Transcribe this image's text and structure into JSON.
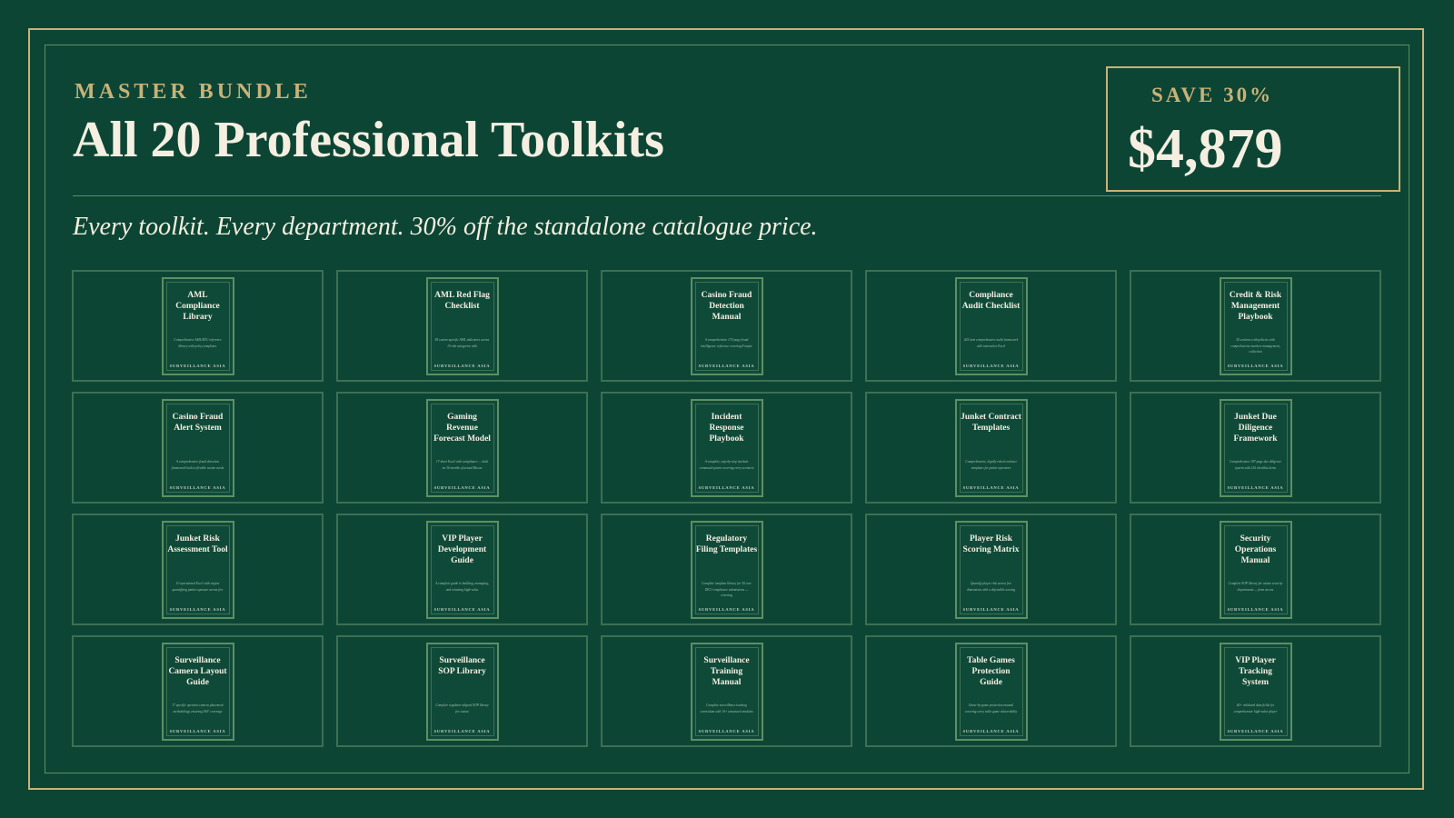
{
  "header": {
    "eyebrow": "MASTER BUNDLE",
    "title": "All 20 Professional Toolkits",
    "tagline": "Every toolkit. Every department. 30% off the standalone catalogue price."
  },
  "offer": {
    "save_label": "SAVE 30%",
    "price": "$4,879"
  },
  "colors": {
    "background": "#0d4535",
    "gold": "#c9b277",
    "cream": "#f4efe1",
    "green_border": "#5d8f63"
  },
  "books": [
    {
      "title": "AML Compliance Library",
      "desc": "Comprehensive AML/KYC reference library with policy templates.",
      "brand": "SURVEILLANCE ASIA"
    },
    {
      "title": "AML Red Flag Checklist",
      "desc": "85 casino-specific AML indicators across 10 risk categories with",
      "brand": "SURVEILLANCE ASIA"
    },
    {
      "title": "Casino Fraud Detection Manual",
      "desc": "A comprehensive 170-page fraud intelligence reference covering 8 major",
      "brand": "SURVEILLANCE ASIA"
    },
    {
      "title": "Compliance Audit Checklist",
      "desc": "265 item comprehensive audit framework with interactive Excel",
      "brand": "SURVEILLANCE ASIA"
    },
    {
      "title": "Credit & Risk Management Playbook",
      "desc": "45 sections with policies with comprehensive markers management, collection",
      "brand": "SURVEILLANCE ASIA"
    },
    {
      "title": "Casino Fraud Alert System",
      "desc": "A comprehensive fraud detection framework built to flexible casino needs",
      "brand": "SURVEILLANCE ASIA"
    },
    {
      "title": "Gaming Revenue Forecast Model",
      "desc": "17-sheet Excel with compliance — built on 36 months of actual Macau",
      "brand": "SURVEILLANCE ASIA"
    },
    {
      "title": "Incident Response Playbook",
      "desc": "A complete, step-by-step incident command system covering every scenario",
      "brand": "SURVEILLANCE ASIA"
    },
    {
      "title": "Junket Contract Templates",
      "desc": "Comprehensive, legally vetted contract templates for junket operators",
      "brand": "SURVEILLANCE ASIA"
    },
    {
      "title": "Junket Due Diligence Framework",
      "desc": "Comprehensive 187-page due diligence system with 126 checklist items",
      "brand": "SURVEILLANCE ASIA"
    },
    {
      "title": "Junket Risk Assessment Tool",
      "desc": "10 operational Excel with engine quantifying junket exposure across five",
      "brand": "SURVEILLANCE ASIA"
    },
    {
      "title": "VIP Player Development Guide",
      "desc": "A complete guide to building, managing, and retaining high-value",
      "brand": "SURVEILLANCE ASIA"
    },
    {
      "title": "Regulatory Filing Templates",
      "desc": "Complete template library for 30 core DICJ compliance submissions — covering",
      "brand": "SURVEILLANCE ASIA"
    },
    {
      "title": "Player Risk Scoring Matrix",
      "desc": "Quantify player risk across five dimensions with a defensible scoring",
      "brand": "SURVEILLANCE ASIA"
    },
    {
      "title": "Security Operations Manual",
      "desc": "Complete SOP library for casino security departments — from access",
      "brand": "SURVEILLANCE ASIA"
    },
    {
      "title": "Surveillance Camera Layout Guide",
      "desc": "17 specific operator camera placement methodology ensuring 360° coverage",
      "brand": "SURVEILLANCE ASIA"
    },
    {
      "title": "Surveillance SOP Library",
      "desc": "Complete regulator-aligned SOP library for casino",
      "brand": "SURVEILLANCE ASIA"
    },
    {
      "title": "Surveillance Training Manual",
      "desc": "Complete surveillance training curriculum with 10+ structured modules",
      "brand": "SURVEILLANCE ASIA"
    },
    {
      "title": "Table Games Protection Guide",
      "desc": "Game-by-game protection manual covering every table game vulnerability",
      "brand": "SURVEILLANCE ASIA"
    },
    {
      "title": "VIP Player Tracking System",
      "desc": "60+ validated data fields for comprehensive high-value player",
      "brand": "SURVEILLANCE ASIA"
    }
  ]
}
